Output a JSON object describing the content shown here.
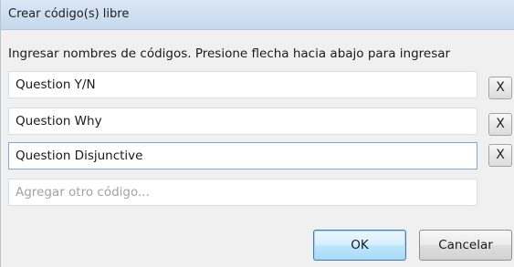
{
  "window": {
    "title": "Crear código(s) libre"
  },
  "instruction": "Ingresar nombres de códigos. Presione flecha hacia abajo para ingresar",
  "codes": [
    {
      "value": "Question Y/N",
      "remove_label": "X"
    },
    {
      "value": "Question Why",
      "remove_label": "X"
    },
    {
      "value": "Question Disjunctive",
      "remove_label": "X"
    }
  ],
  "new_code": {
    "value": "",
    "placeholder": "Agregar otro código..."
  },
  "buttons": {
    "ok": "OK",
    "cancel": "Cancelar"
  }
}
